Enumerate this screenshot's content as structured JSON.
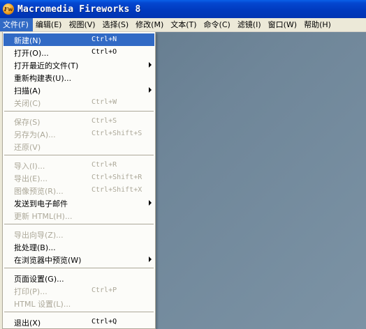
{
  "window": {
    "title": "Macromedia Fireworks 8",
    "app_icon_glyph": "Fw"
  },
  "menubar": [
    "文件(F)",
    "编辑(E)",
    "视图(V)",
    "选择(S)",
    "修改(M)",
    "文本(T)",
    "命令(C)",
    "滤镜(I)",
    "窗口(W)",
    "帮助(H)"
  ],
  "file_menu": [
    {
      "label": "新建(N)",
      "shortcut": "Ctrl+N"
    },
    {
      "label": "打开(O)...",
      "shortcut": "Ctrl+O"
    },
    {
      "label": "打开最近的文件(T)",
      "shortcut": ""
    },
    {
      "label": "重新构建表(U)...",
      "shortcut": ""
    },
    {
      "label": "扫描(A)",
      "shortcut": ""
    },
    {
      "label": "关闭(C)",
      "shortcut": "Ctrl+W"
    },
    {
      "label": "保存(S)",
      "shortcut": "Ctrl+S"
    },
    {
      "label": "另存为(A)...",
      "shortcut": "Ctrl+Shift+S"
    },
    {
      "label": "还原(V)",
      "shortcut": ""
    },
    {
      "label": "导入(I)...",
      "shortcut": "Ctrl+R"
    },
    {
      "label": "导出(E)...",
      "shortcut": "Ctrl+Shift+R"
    },
    {
      "label": "图像预览(R)...",
      "shortcut": "Ctrl+Shift+X"
    },
    {
      "label": "发送到电子邮件",
      "shortcut": ""
    },
    {
      "label": "更新 HTML(H)...",
      "shortcut": ""
    },
    {
      "label": "导出向导(Z)...",
      "shortcut": ""
    },
    {
      "label": "批处理(B)...",
      "shortcut": ""
    },
    {
      "label": "在浏览器中预览(W)",
      "shortcut": ""
    },
    {
      "label": "页面设置(G)...",
      "shortcut": ""
    },
    {
      "label": "打印(P)...",
      "shortcut": "Ctrl+P"
    },
    {
      "label": "HTML 设置(L)...",
      "shortcut": ""
    },
    {
      "label": "退出(X)",
      "shortcut": "Ctrl+Q"
    }
  ]
}
